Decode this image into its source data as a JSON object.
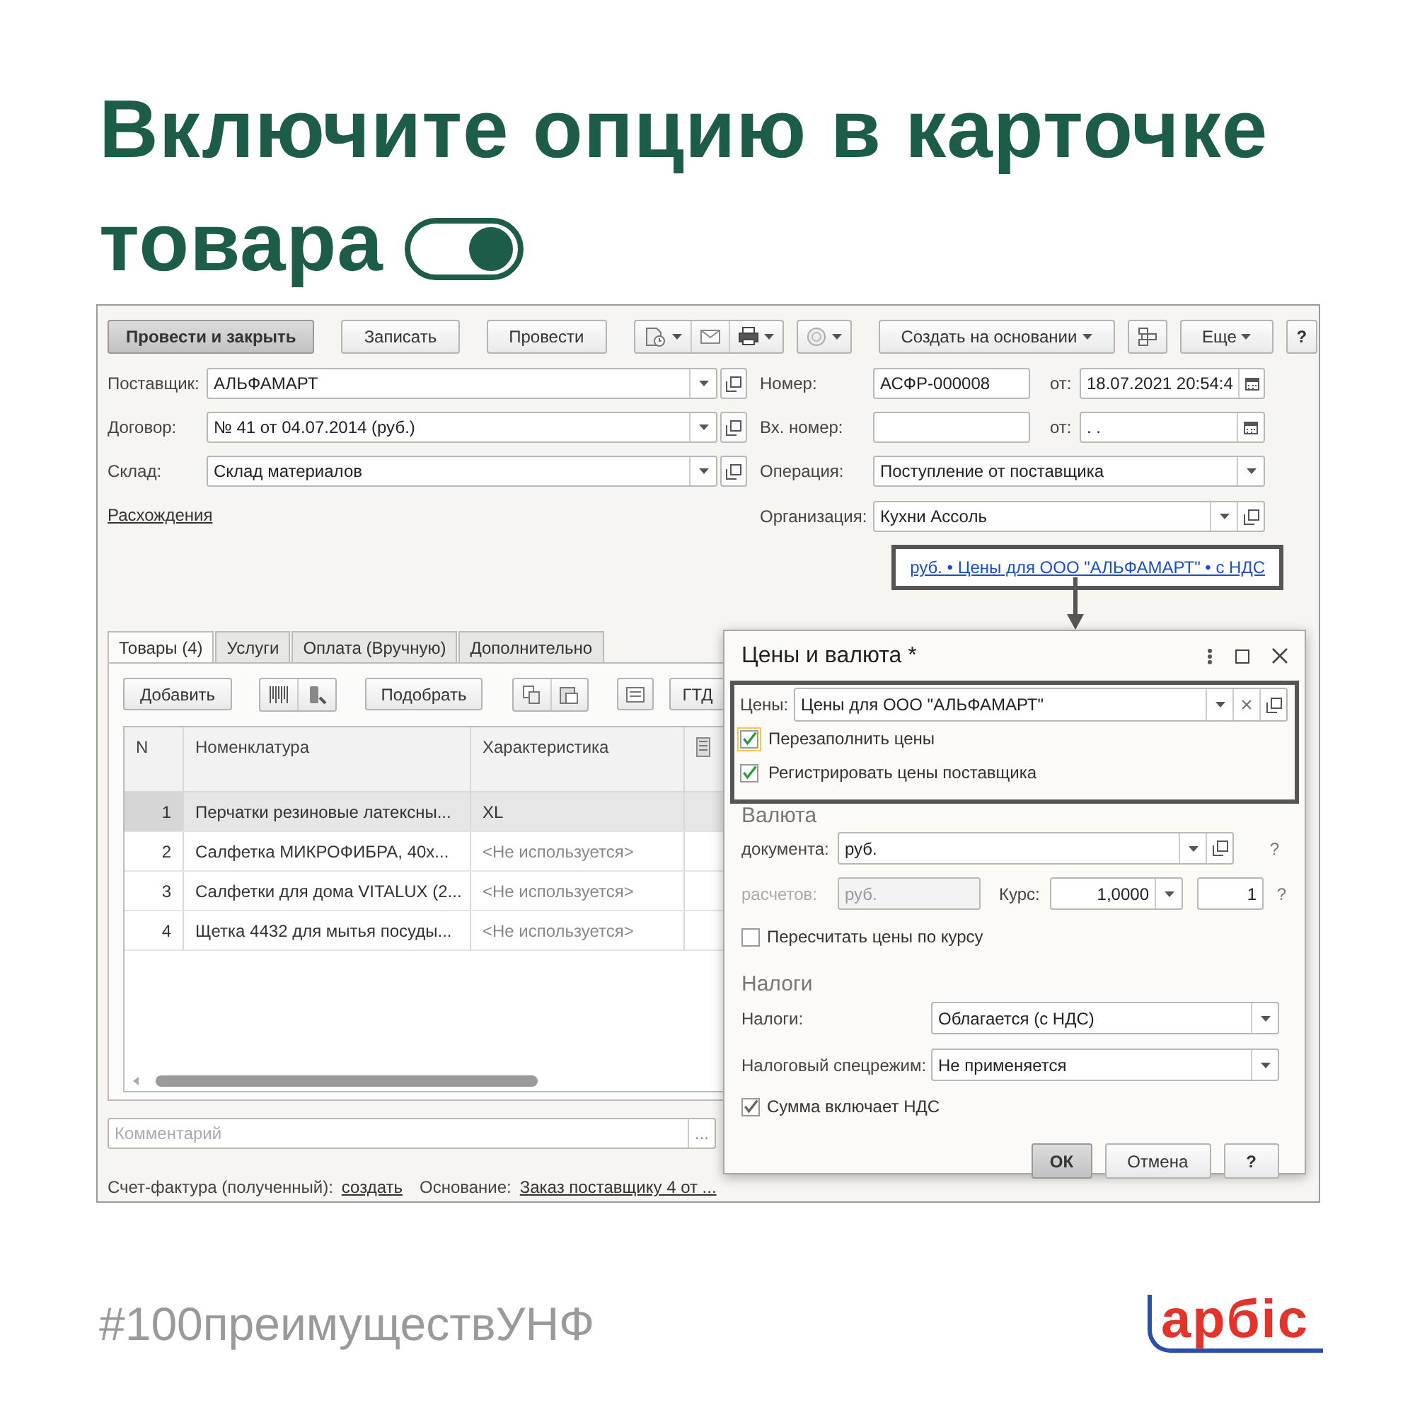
{
  "headline": {
    "text": "Включите опцию в карточке товара",
    "toggle_on": true
  },
  "toolbar": {
    "buttons": [
      {
        "label": "Провести и закрыть",
        "default": true
      },
      {
        "label": "Записать",
        "default": false
      },
      {
        "label": "Провести",
        "default": false
      }
    ],
    "create_based_on": "Создать на основании",
    "more": "Еще",
    "help": "?"
  },
  "header_fields": {
    "left": [
      {
        "label": "Поставщик:",
        "value": "АЛЬФАМАРТ"
      },
      {
        "label": "Договор:",
        "value": "№ 41 от 04.07.2014 (руб.)"
      },
      {
        "label": "Склад:",
        "value": "Склад материалов"
      }
    ],
    "discrepancies_link": "Расхождения",
    "number": {
      "label": "Номер:",
      "value": "АСФР-000008",
      "date_label": "от:",
      "date": "18.07.2021 20:54:4"
    },
    "incoming_number": {
      "label": "Вх. номер:",
      "date_label": "от:",
      "date": ". ."
    },
    "operation": {
      "label": "Операция:",
      "value": "Поступление от поставщика"
    },
    "organization": {
      "label": "Организация:",
      "value": "Кухни Ассоль"
    },
    "prices_link": "руб. • Цены для ООО \"АЛЬФАМАРТ\" • с НДС"
  },
  "tabs": [
    {
      "label": "Товары (4)",
      "selected": true
    },
    {
      "label": "Услуги",
      "selected": false
    },
    {
      "label": "Оплата (Вручную)",
      "selected": false
    },
    {
      "label": "Дополнительно",
      "selected": false
    }
  ],
  "tab_toolbar": {
    "add": "Добавить",
    "pick": "Подобрать",
    "customs": "ГТД"
  },
  "table": {
    "columns": [
      "N",
      "Номенклатура",
      "Характеристика"
    ],
    "rows": [
      {
        "n": "1",
        "item": "Перчатки резиновые латексны...",
        "characteristic": "XL",
        "selected": true,
        "dimmed": false
      },
      {
        "n": "2",
        "item": "Салфетка МИКРОФИБРА, 40х...",
        "characteristic": "<Не используется>",
        "selected": false,
        "dimmed": true
      },
      {
        "n": "3",
        "item": "Салфетки для дома VITALUX (2...",
        "characteristic": "<Не используется>",
        "selected": false,
        "dimmed": true
      },
      {
        "n": "4",
        "item": "Щетка 4432 для мытья посуды...",
        "characteristic": "<Не используется>",
        "selected": false,
        "dimmed": true
      }
    ]
  },
  "comment": {
    "placeholder": "Комментарий",
    "button": "..."
  },
  "footer": {
    "invoice_label": "Счет-фактура (полученный):",
    "invoice_link": "создать",
    "basis_label": "Основание:",
    "basis_link": "Заказ поставщику 4 от ..."
  },
  "dialog": {
    "title": "Цены и валюта *",
    "prices": {
      "label": "Цены:",
      "value": "Цены для ООО \"АЛЬФАМАРТ\""
    },
    "checks": [
      {
        "label": "Перезаполнить цены",
        "checked": true,
        "focused": true
      },
      {
        "label": "Регистрировать цены поставщика",
        "checked": true,
        "focused": false
      }
    ],
    "currency_heading": "Валюта",
    "doc_currency": {
      "label": "документа:",
      "value": "руб.",
      "help": "?"
    },
    "settlement": {
      "label": "расчетов:",
      "value": "руб.",
      "disabled": true
    },
    "rate": {
      "label": "Курс:",
      "value": "1,0000",
      "multiplier": "1",
      "help": "?"
    },
    "recalc": {
      "label": "Пересчитать цены по курсу",
      "checked": false
    },
    "taxes_heading": "Налоги",
    "taxes": [
      {
        "label": "Налоги:",
        "value": "Облагается (с НДС)"
      },
      {
        "label": "Налоговый спецрежим:",
        "value": "Не применяется"
      }
    ],
    "vat_included": {
      "label": "Сумма включает НДС",
      "checked": true
    },
    "buttons": [
      {
        "label": "ОК",
        "default": true
      },
      {
        "label": "Отмена",
        "default": false
      },
      {
        "label": "?",
        "default": false
      }
    ]
  },
  "hashtag": "#100преимуществУНФ",
  "logo": "арбіс"
}
